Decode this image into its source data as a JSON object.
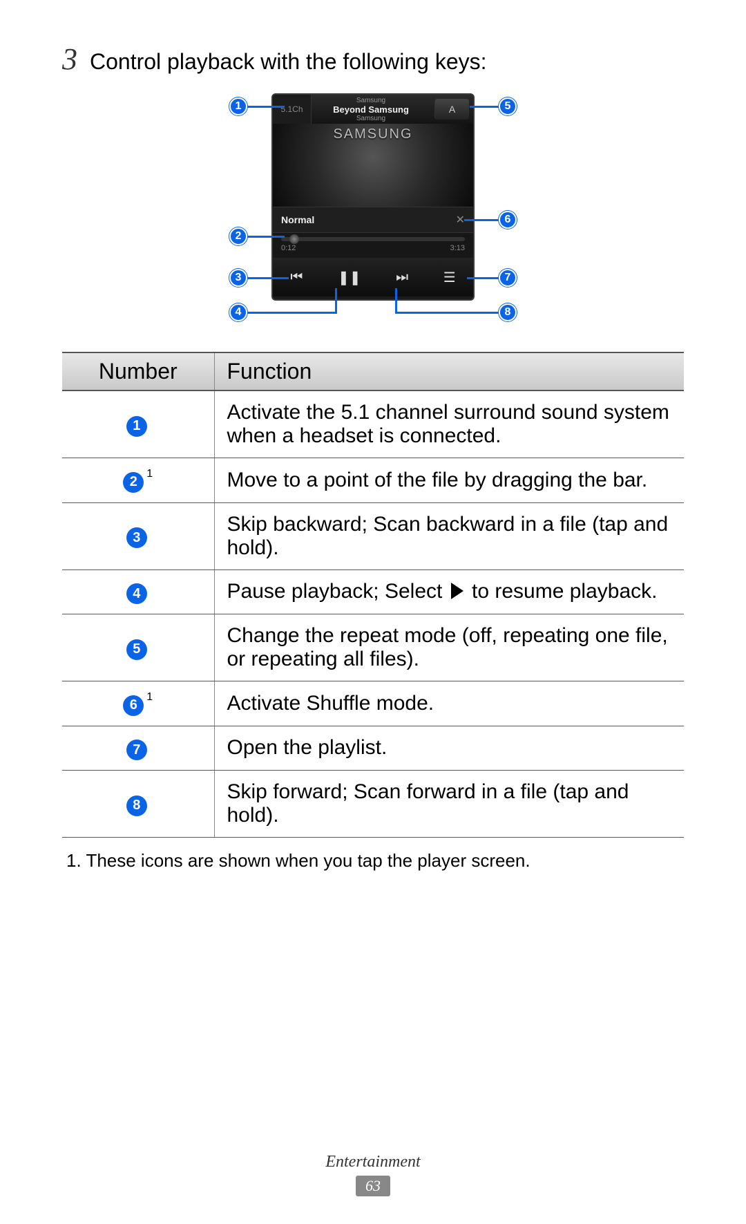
{
  "step": {
    "number": "3",
    "text": "Control playback with the following keys:"
  },
  "player": {
    "btn51": "5.1Ch",
    "artist_top": "Samsung",
    "track": "Beyond Samsung",
    "artist_bottom": "Samsung",
    "repeat": "A",
    "logo": "SAMSUNG",
    "eq": "Normal",
    "shuffle_glyph": "✕",
    "time_elapsed": "0:12",
    "time_total": "3:13",
    "prev": "⏮",
    "pause": "❚❚",
    "next": "⏭",
    "playlist": "☰"
  },
  "callouts": [
    "1",
    "2",
    "3",
    "4",
    "5",
    "6",
    "7",
    "8"
  ],
  "table": {
    "head_number": "Number",
    "head_function": "Function",
    "rows": [
      {
        "n": "1",
        "sup": "",
        "fn": "Activate the 5.1 channel surround sound system when a headset is connected."
      },
      {
        "n": "2",
        "sup": "1",
        "fn": "Move to a point of the file by dragging the bar."
      },
      {
        "n": "3",
        "sup": "",
        "fn": "Skip backward; Scan backward in a file (tap and hold)."
      },
      {
        "n": "4",
        "sup": "",
        "fn_pre": "Pause playback; Select ",
        "fn_post": " to resume playback.",
        "has_tri": true
      },
      {
        "n": "5",
        "sup": "",
        "fn": "Change the repeat mode (off, repeating one file, or repeating all files)."
      },
      {
        "n": "6",
        "sup": "1",
        "fn": "Activate Shuffle mode."
      },
      {
        "n": "7",
        "sup": "",
        "fn": "Open the playlist."
      },
      {
        "n": "8",
        "sup": "",
        "fn": "Skip forward; Scan forward in a file (tap and hold)."
      }
    ]
  },
  "footnote": "1.  These icons are shown when you tap the player screen.",
  "footer": {
    "section": "Entertainment",
    "page": "63"
  }
}
